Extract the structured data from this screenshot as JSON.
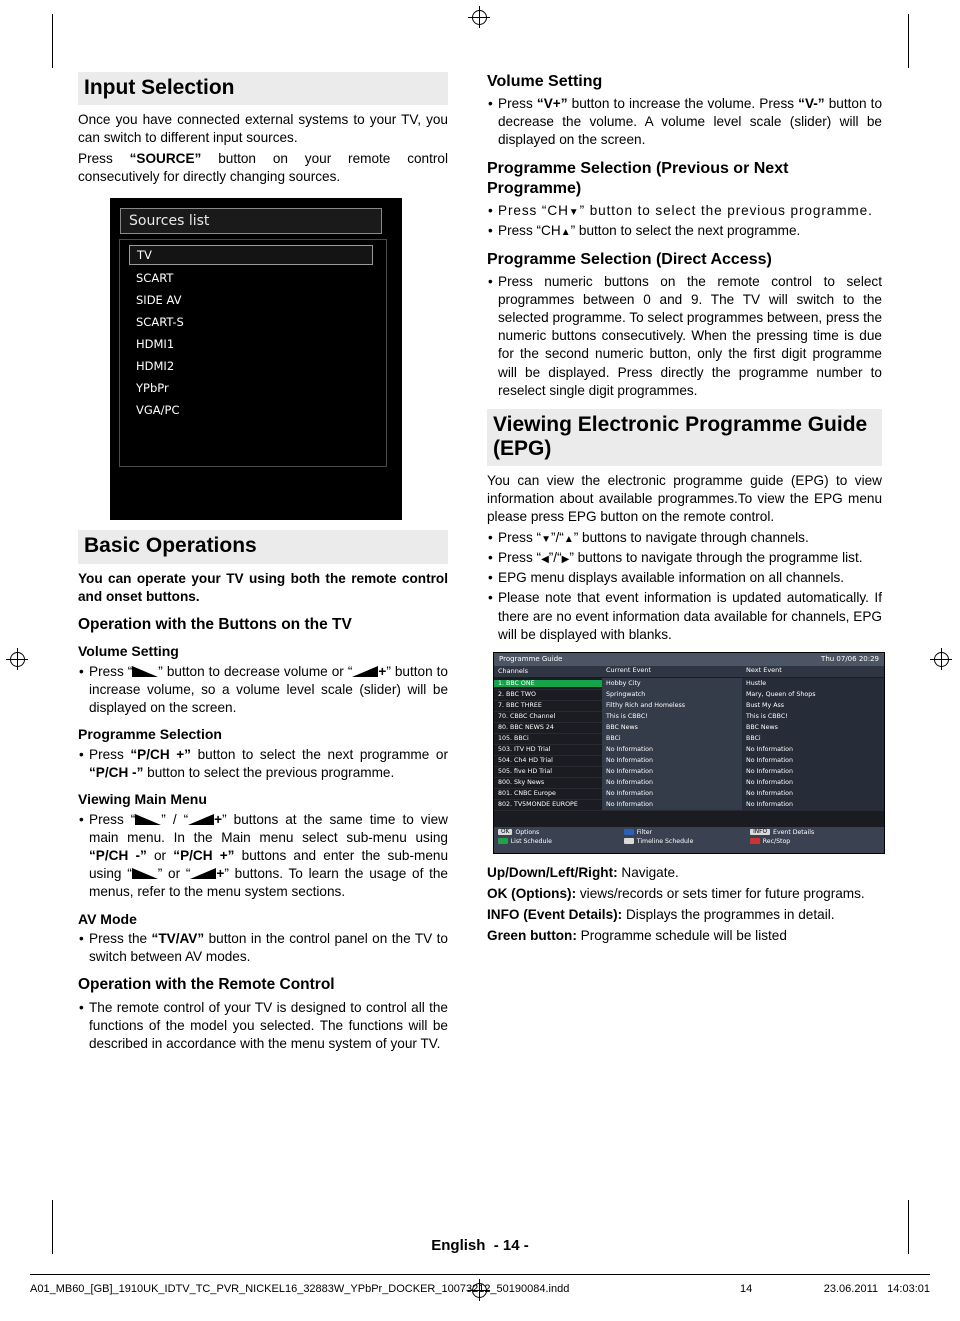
{
  "page": {
    "footer_language": "English",
    "footer_pagenum": "- 14 -",
    "file_name": "A01_MB60_[GB]_1910UK_IDTV_TC_PVR_NICKEL16_32883W_YPbPr_DOCKER_10073212_50190084.indd",
    "file_page": "14",
    "file_date": "23.06.2011",
    "file_time": "14:03:01"
  },
  "left": {
    "input_selection": {
      "title": "Input Selection",
      "p1": "Once you have connected external systems to your TV, you can switch to different input sources.",
      "p2_a": "Press ",
      "p2_b": "“SOURCE”",
      "p2_c": " button on your remote control consecutively for directly changing sources."
    },
    "sources_image": {
      "title": "Sources list",
      "selected": "TV",
      "items": [
        "SCART",
        "SIDE AV",
        "SCART-S",
        "HDMI1",
        "HDMI2",
        "YPbPr",
        "VGA/PC"
      ]
    },
    "basic_operations": {
      "title": "Basic Operations",
      "intro": "You can operate your TV using both the remote control and onset buttons.",
      "buttons_on_tv_title": "Operation with the Buttons on the TV",
      "volume_title": "Volume Setting",
      "volume_item_a": "Press “",
      "volume_item_b": "” button to decrease volume or “",
      "volume_item_c": "” button to increase volume, so a volume level scale (slider) will be displayed on the screen.",
      "programme_selection_title": "Programme Selection",
      "programme_item_a": "Press ",
      "programme_item_b": "“P/CH +”",
      "programme_item_c": " button to select the next programme or ",
      "programme_item_d": "“P/CH -”",
      "programme_item_e": " button to select the previous programme.",
      "main_menu_title": "Viewing Main Menu",
      "main_menu_a": "Press “",
      "main_menu_b": "” / “",
      "main_menu_c": "” buttons at the same time to view main menu. In the Main menu select sub-menu using ",
      "main_menu_d": "“P/CH -”",
      "main_menu_e": " or ",
      "main_menu_f": "“P/CH +”",
      "main_menu_g": " buttons and enter the sub-menu using “",
      "main_menu_h": "” or “",
      "main_menu_i": "” buttons. To learn the usage of the menus, refer to the menu system sections.",
      "av_mode_title": "AV Mode",
      "av_mode_a": "Press the ",
      "av_mode_b": "“TV/AV”",
      "av_mode_c": " button in the control panel on the TV to switch between AV modes.",
      "remote_title": "Operation with the Remote Control",
      "remote_item": "The remote control of your TV is designed to control all the functions of the model you selected. The functions will be described in accordance with the menu system of your TV."
    }
  },
  "right": {
    "volume_setting": {
      "title": "Volume Setting",
      "item_a": "Press ",
      "item_b": "“V+”",
      "item_c": " button to increase the volume. Press ",
      "item_d": "“V-”",
      "item_e": " button to decrease the volume. A volume level scale (slider) will be displayed on the screen."
    },
    "programme_selection_prev_next": {
      "title": "Programme Selection (Previous or Next Programme)",
      "item1_a": "Press “CH",
      "item1_b": "” button to select the previous programme.",
      "item2_a": "Press “CH",
      "item2_b": "” button to select the next programme."
    },
    "programme_selection_direct": {
      "title": "Programme Selection (Direct Access)",
      "item": "Press numeric buttons on the remote control to select programmes between 0 and 9. The TV will switch to the selected programme. To select programmes between, press the numeric buttons consecutively. When the pressing time is due for the second numeric button, only the first digit programme will be displayed. Press directly the programme number to reselect single digit programmes."
    },
    "epg": {
      "title": "Viewing Electronic Programme Guide (EPG)",
      "intro": "You can view the electronic programme guide (EPG) to view information about available programmes.To view the EPG menu please press EPG button on the remote control.",
      "bullet1_a": "Press “",
      "bullet1_b": "”/“",
      "bullet1_c": "” buttons to navigate through channels.",
      "bullet2_a": "Press “",
      "bullet2_b": "”/“",
      "bullet2_c": "” buttons to navigate through the programme list.",
      "bullet3": "EPG menu displays available information on all channels.",
      "bullet4": "Please note that event information is updated automatically. If there are no event information data available for channels, EPG will be displayed with blanks.",
      "legend": [
        {
          "key": "Up/Down/Left/Right:",
          "text": " Navigate."
        },
        {
          "key": "OK (Options):",
          "text": " views/records or sets timer for future programs."
        },
        {
          "key": "INFO (Event Details):",
          "text": " Displays the programmes in detail."
        },
        {
          "key": "Green button:",
          "text": " Programme schedule will be listed"
        }
      ]
    },
    "epg_image": {
      "title": "Programme Guide",
      "clock": "Thu 07/06 20:29",
      "headers": [
        "Channels",
        "Current Event",
        "Next Event"
      ],
      "rows": [
        {
          "ch": "1. BBC ONE",
          "cur": "Hobby City",
          "next": "Hustle",
          "rec": true,
          "sel": true
        },
        {
          "ch": "2. BBC TWO",
          "cur": "Springwatch",
          "next": "Mary, Queen of Shops",
          "rec": false,
          "sel": false
        },
        {
          "ch": "7. BBC THREE",
          "cur": "Filthy Rich and Homeless",
          "next": "Bust My Ass",
          "rec": false,
          "sel": false
        },
        {
          "ch": "70. CBBC Channel",
          "cur": "This is CBBC!",
          "next": "This is CBBC!",
          "rec": false,
          "sel": false
        },
        {
          "ch": "80. BBC NEWS 24",
          "cur": "BBC News",
          "next": "BBC News",
          "rec": false,
          "sel": false
        },
        {
          "ch": "105. BBCi",
          "cur": "BBCi",
          "next": "BBCi",
          "rec": false,
          "sel": false
        },
        {
          "ch": "503. ITV HD Trial",
          "cur": "No Information",
          "next": "No Information",
          "rec": true,
          "sel": false
        },
        {
          "ch": "504. Ch4 HD Trial",
          "cur": "No Information",
          "next": "No Information",
          "rec": true,
          "sel": false
        },
        {
          "ch": "505. five HD Trial",
          "cur": "No Information",
          "next": "No Information",
          "rec": false,
          "sel": false
        },
        {
          "ch": "800. Sky News",
          "cur": "No Information",
          "next": "No Information",
          "rec": false,
          "sel": false
        },
        {
          "ch": "801. CNBC Europe",
          "cur": "No Information",
          "next": "No Information",
          "rec": false,
          "sel": false
        },
        {
          "ch": "802. TV5MONDE EUROPE",
          "cur": "No Information",
          "next": "No Information",
          "rec": false,
          "sel": false
        }
      ],
      "footer_buttons": [
        {
          "key": "OK",
          "label": "Options",
          "color": "grey"
        },
        {
          "key": "",
          "label": "Filter",
          "color": "blue"
        },
        {
          "key": "INFO",
          "label": "Event Details",
          "color": "grey"
        },
        {
          "key": "",
          "label": "List Schedule",
          "color": "green"
        },
        {
          "key": "",
          "label": "Timeline Schedule",
          "color": "grey"
        },
        {
          "key": "",
          "label": "Rec/Stop",
          "color": "red"
        }
      ]
    }
  }
}
